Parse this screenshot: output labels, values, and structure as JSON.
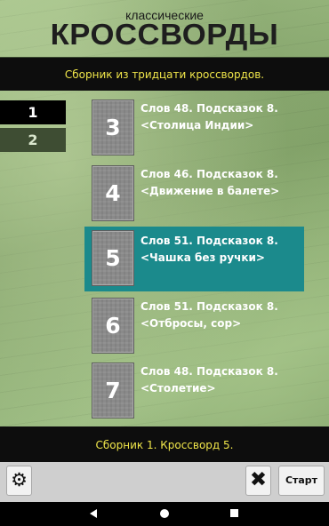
{
  "header": {
    "subtitle": "классические",
    "title": "КРОССВОРДЫ"
  },
  "collection_info": "Сборник из тридцати кроссвордов.",
  "pages": [
    "1",
    "2"
  ],
  "items": [
    {
      "number": "3",
      "line1": "Слов 48. Подсказок 8.",
      "line2": "<Столица Индии>"
    },
    {
      "number": "4",
      "line1": "Слов 46. Подсказок 8.",
      "line2": "<Движение в балете>"
    },
    {
      "number": "5",
      "line1": "Слов 51. Подсказок 8.",
      "line2": "<Чашка без ручки>"
    },
    {
      "number": "6",
      "line1": "Слов 51. Подсказок 8.",
      "line2": "<Отбросы, сор>"
    },
    {
      "number": "7",
      "line1": "Слов 48. Подсказок 8.",
      "line2": "<Столетие>"
    }
  ],
  "status": "Сборник 1. Кроссворд 5.",
  "toolbar": {
    "settings_icon": "gear-icon",
    "close_icon": "close-icon",
    "start_label": "Старт"
  },
  "colors": {
    "accent_text": "#f0e64a",
    "selected_bg": "#1b8a8c"
  }
}
